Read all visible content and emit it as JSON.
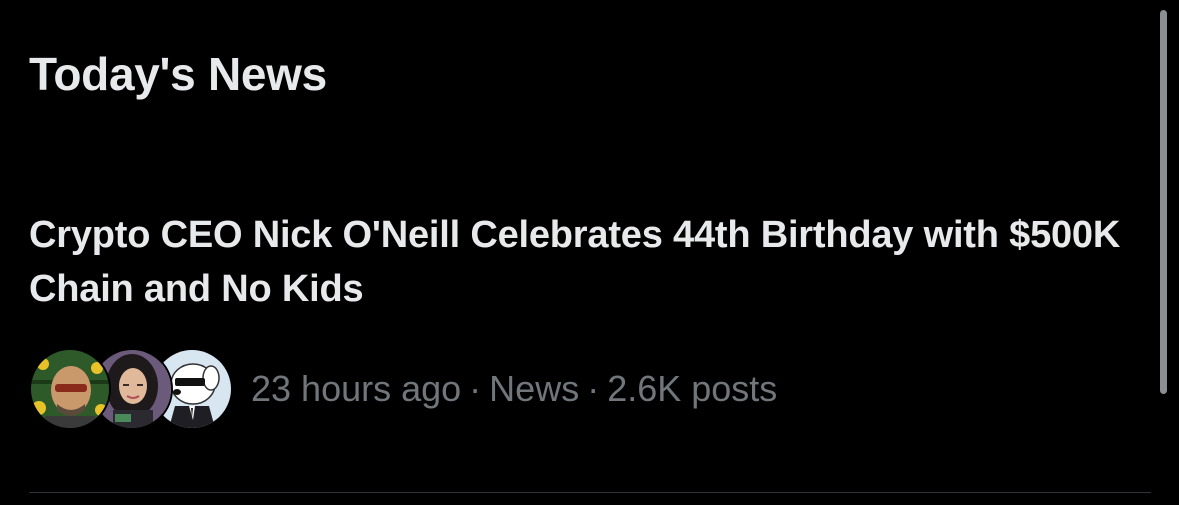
{
  "section": {
    "title": "Today's News"
  },
  "news_item": {
    "headline": "Crypto CEO Nick O'Neill Celebrates 44th Birthday with $500K Chain and No Kids",
    "time": "23 hours ago",
    "separator": "·",
    "category": "News",
    "posts": "2.6K posts",
    "avatars": [
      {
        "icon": "user-avatar-1"
      },
      {
        "icon": "user-avatar-2"
      },
      {
        "icon": "user-avatar-3"
      }
    ]
  },
  "colors": {
    "background": "#000000",
    "primary_text": "#e7e9ea",
    "secondary_text": "#71767b",
    "divider": "#2f3336",
    "scrollbar": "#8b8f93"
  }
}
